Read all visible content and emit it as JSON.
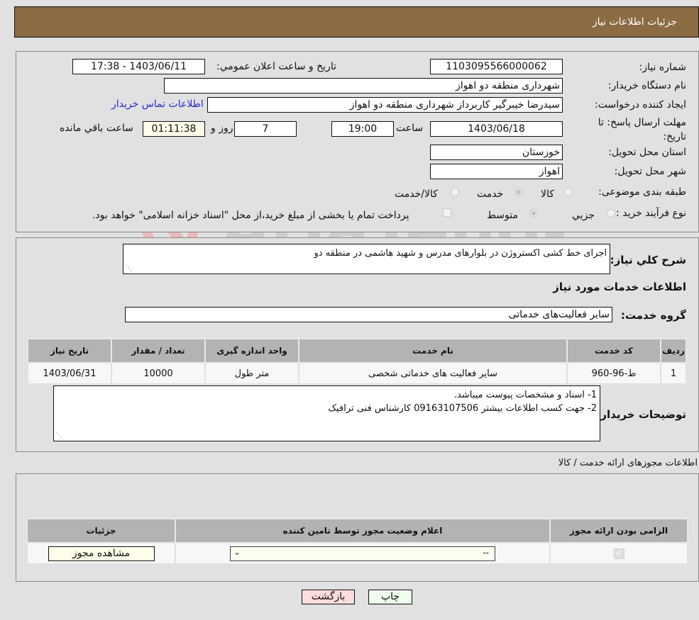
{
  "header": {
    "title": "جزئیات اطلاعات نیاز"
  },
  "form": {
    "need_number": {
      "label": "شماره نیاز:",
      "value": "1103095566000062"
    },
    "announce_datetime": {
      "label": "تاریخ و ساعت اعلان عمومي:",
      "value": "1403/06/11 - 17:38"
    },
    "buyer_org": {
      "label": "نام دستگاه خریدار:",
      "value": "شهرداری منطقه دو اهواز"
    },
    "requester": {
      "label": "ایجاد کننده درخواست:",
      "value": "سیدرضا خیبرگیر کاربرداز  شهرداری منطقه دو اهواز"
    },
    "buyer_contact_link": "اطلاعات تماس خریدار",
    "deadline": {
      "label": "مهلت ارسال پاسخ: تا تاریخ:",
      "date": "1403/06/18",
      "time_label": "ساعت",
      "time": "19:00",
      "days": "7",
      "days_label": "روز و",
      "remaining": "01:11:38",
      "remaining_label": "ساعت باقي مانده"
    },
    "province": {
      "label": "استان محل تحویل:",
      "value": "خوزستان"
    },
    "city": {
      "label": "شهر محل تحویل:",
      "value": "اهواز"
    },
    "category": {
      "label": "طبقه بندی موضوعی:",
      "options": [
        "کالا",
        "خدمت",
        "کالا/خدمت"
      ],
      "selected": "خدمت"
    },
    "purchase_type": {
      "label": "نوع فرآیند خرید :",
      "options": [
        "جزیي",
        "متوسط"
      ],
      "selected": "متوسط",
      "treasury_note": "پرداخت تمام یا بخشی از مبلغ خرید،از محل \"اسناد خزانه اسلامی\" خواهد بود."
    }
  },
  "summary": {
    "label": "شرح کلي نیاز:",
    "value": "اجرای خط کشی اکستروژن در بلوارهای مدرس و شهید هاشمی در منطقه دو",
    "services_heading": "اطلاعات خدمات مورد نیاز",
    "service_group_label": "گروه خدمت:",
    "service_group_value": "سایر فعالیت‌های خدماتی"
  },
  "services_table": {
    "headers": [
      "ردیف",
      "کد خدمت",
      "نام خدمت",
      "واحد اندازه گیری",
      "تعداد / مقدار",
      "تاریخ نیاز"
    ],
    "rows": [
      [
        "1",
        "ط-96-960",
        "سایر فعالیت های خدماتی شخصی",
        "متر طول",
        "10000",
        "1403/06/31"
      ]
    ]
  },
  "buyer_notes": {
    "label": "توضیحات خریدار:",
    "lines": [
      "1- اسناد و مشخصات پیوست میباشد.",
      "2- جهت کسب اطلاعات بیشتر 09163107506 کارشناس فنی ترافیک"
    ]
  },
  "permits": {
    "heading": "اطلاعات مجوزهای ارائه خدمت / کالا",
    "headers": [
      "الزامی بودن ارائه مجوز",
      "اعلام وضعیت مجوز توسط تامین کننده",
      "جزئیات"
    ],
    "row": {
      "required_checked": true,
      "status_value": "--",
      "details_button": "مشاهده مجوز"
    }
  },
  "footer": {
    "back_button": "بازگشت",
    "print_button": "چاپ"
  },
  "watermark": {
    "text": "AriaTender.net"
  }
}
